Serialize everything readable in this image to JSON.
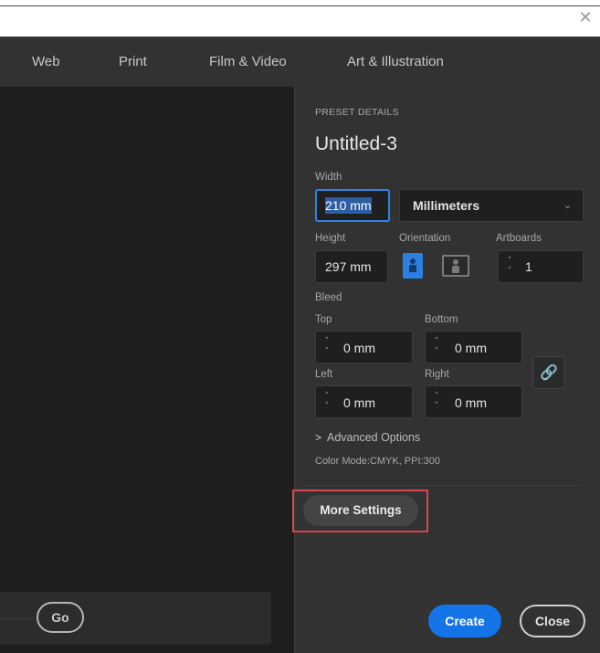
{
  "window": {
    "close_icon": "✕"
  },
  "tabs": [
    "Web",
    "Print",
    "Film & Video",
    "Art & Illustration"
  ],
  "search": {
    "go_label": "Go"
  },
  "preset": {
    "section_label": "PRESET DETAILS",
    "title": "Untitled-3",
    "width_label": "Width",
    "width_value": "210 mm",
    "units": "Millimeters",
    "height_label": "Height",
    "height_value": "297 mm",
    "orientation_label": "Orientation",
    "orientation_selected": "portrait",
    "artboards_label": "Artboards",
    "artboards_value": "1",
    "bleed_label": "Bleed",
    "bleed": {
      "top_label": "Top",
      "top_value": "0 mm",
      "bottom_label": "Bottom",
      "bottom_value": "0 mm",
      "left_label": "Left",
      "left_value": "0 mm",
      "right_label": "Right",
      "right_value": "0 mm"
    },
    "advanced_label": "Advanced Options",
    "color_mode": "Color Mode:CMYK, PPI:300"
  },
  "buttons": {
    "more_settings": "More Settings",
    "create": "Create",
    "close": "Close"
  },
  "colors": {
    "accent": "#1473e6",
    "panel_bg": "#323232",
    "canvas_bg": "#1e1e1e",
    "highlight": "#d8474b"
  },
  "icons": {
    "chevron": "chevron-down-icon",
    "caret": "chevron-right-icon",
    "link": "link-icon"
  }
}
